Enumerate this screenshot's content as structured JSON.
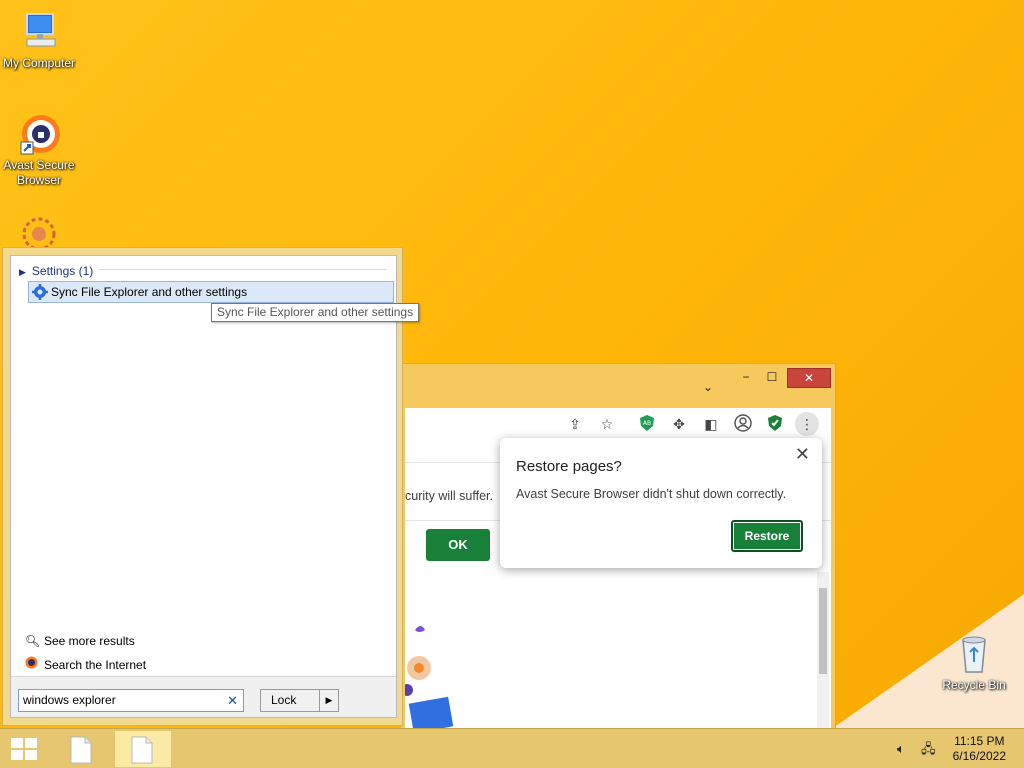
{
  "desktop": {
    "icons": [
      {
        "label": "My Computer",
        "icon": "computer-icon"
      },
      {
        "label": "Avast Secure Browser",
        "icon": "avast-browser-icon"
      },
      {
        "label": "Recycle Bin",
        "icon": "recycle-bin-icon"
      }
    ]
  },
  "search_panel": {
    "category": "Settings (1)",
    "result": "Sync File Explorer and other settings",
    "tooltip": "Sync File Explorer and other settings",
    "see_more": "See more results",
    "search_internet": "Search the Internet",
    "query": "windows explorer",
    "lock_label": "Lock"
  },
  "browser": {
    "partial_text": "curity will suffer.",
    "ok_label": "OK",
    "popup": {
      "title": "Restore pages?",
      "message": "Avast Secure Browser didn't shut down correctly.",
      "restore_label": "Restore"
    }
  },
  "taskbar": {
    "time": "11:15 PM",
    "date": "6/16/2022"
  },
  "colors": {
    "wallpaper": "#ffb80a",
    "accent_green": "#188038",
    "close_red": "#c8453b"
  }
}
